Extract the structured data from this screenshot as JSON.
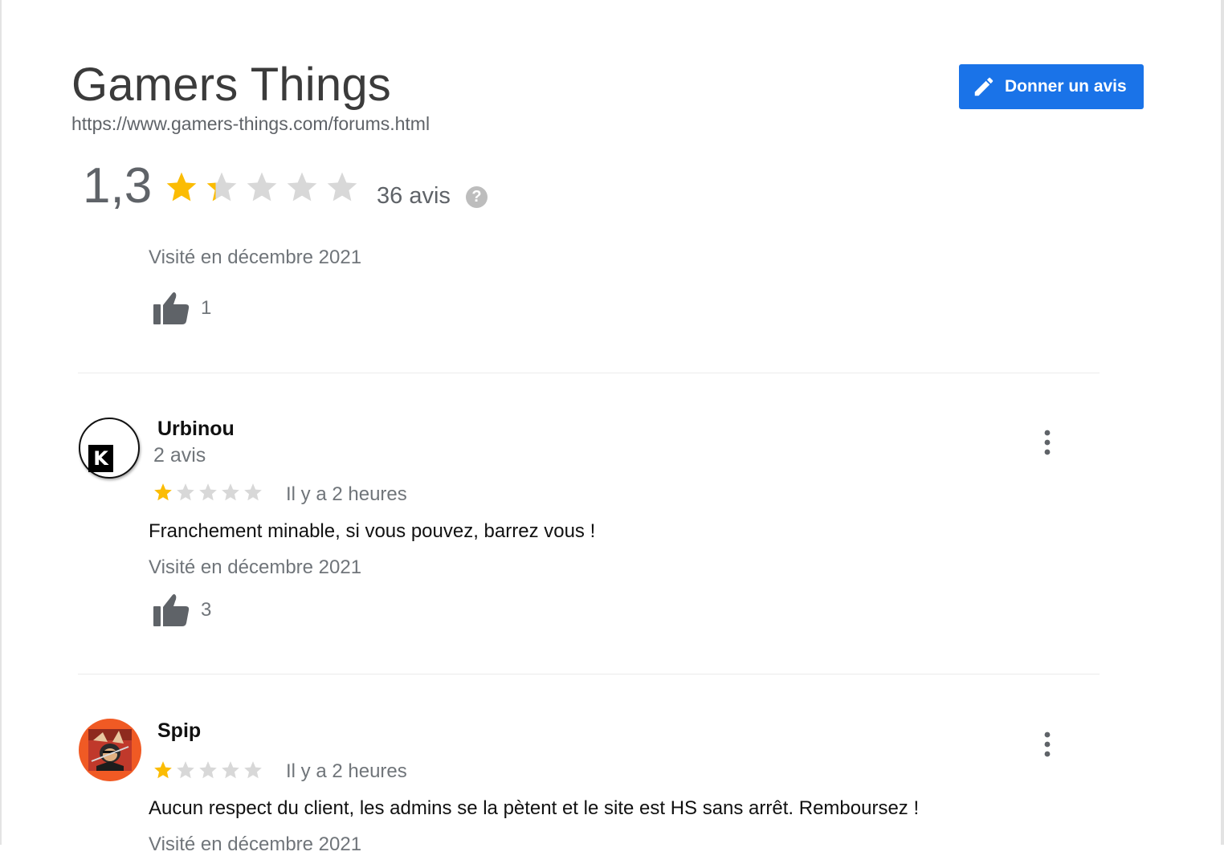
{
  "header": {
    "title": "Gamers Things",
    "url": "https://www.gamers-things.com/forums.html",
    "write_review_label": "Donner un avis"
  },
  "summary": {
    "score": "1,3",
    "rating_value": 1.3,
    "rating_max": 5,
    "count_label": "36 avis",
    "help_icon": "?"
  },
  "previous_review": {
    "visited": "Visité en décembre 2021",
    "likes": "1"
  },
  "reviews": [
    {
      "name": "Urbinou",
      "review_count": "2 avis",
      "rating": 1,
      "time": "Il y a 2 heures",
      "text": "Franchement minable, si vous pouvez, barrez vous !",
      "visited": "Visité en décembre 2021",
      "likes": "3",
      "avatar_letter": "K"
    },
    {
      "name": "Spip",
      "rating": 1,
      "time": "Il y a 2 heures",
      "text": "Aucun respect du client, les admins se la pètent et le site est HS sans arrêt. Remboursez !",
      "visited": "Visité en décembre 2021"
    }
  ],
  "icons": {
    "write": "pencil-icon",
    "help": "question-circle-icon",
    "like": "thumbs-up-icon",
    "more": "more-vertical-icon",
    "star": "star-icon"
  },
  "colors": {
    "accent_blue": "#1a73e8",
    "star_filled": "#fbbc04",
    "star_empty": "#d8d8d8",
    "secondary_text": "#70757a",
    "avatar_spip_bg": "#f05a24"
  }
}
